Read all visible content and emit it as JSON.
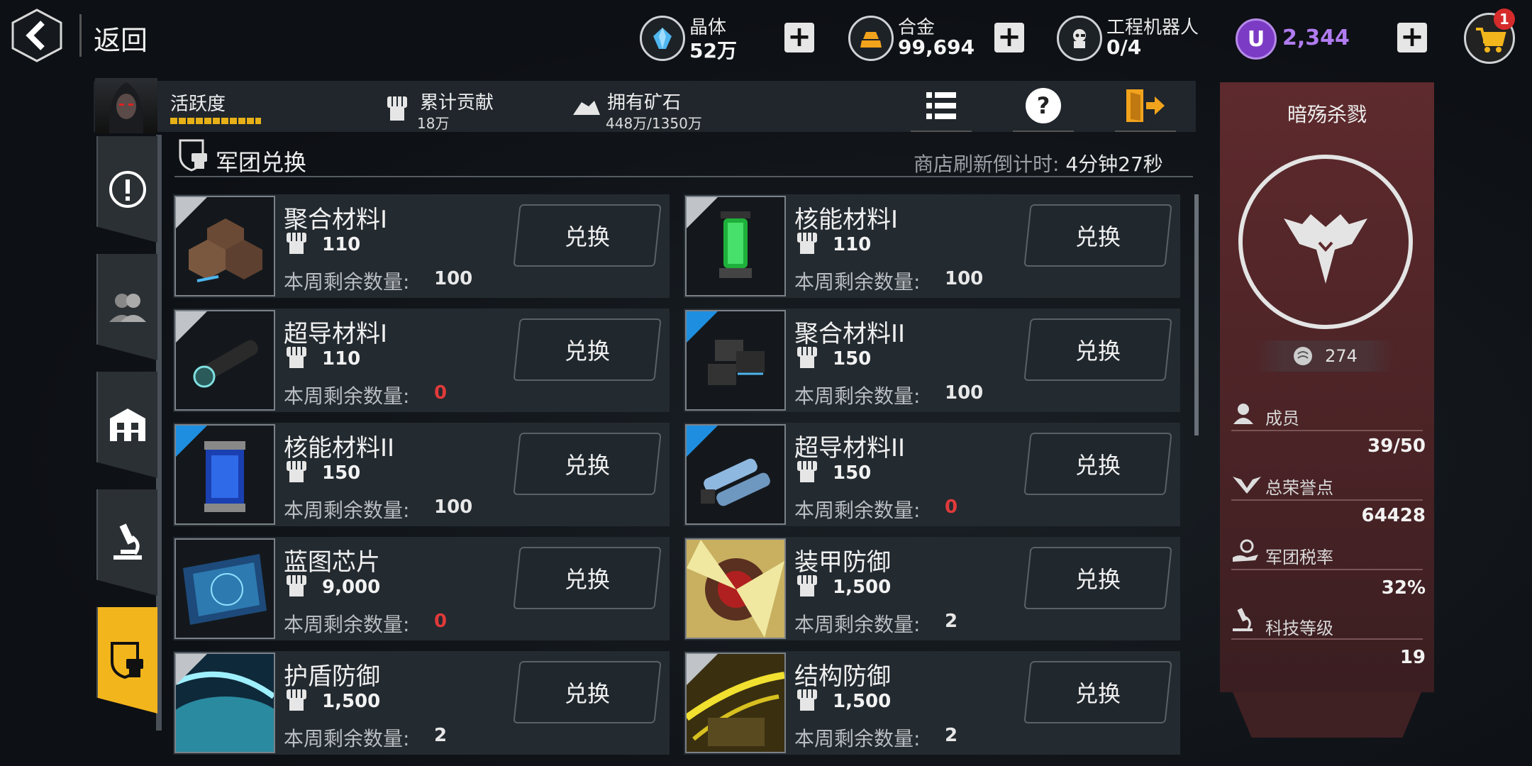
{
  "header": {
    "back_label": "返回",
    "resources": [
      {
        "name": "晶体",
        "value": "52万",
        "icon": "crystal-icon",
        "color": "#4fb6ef"
      },
      {
        "name": "合金",
        "value": "99,694",
        "icon": "alloy-icon",
        "color": "#f2a31c"
      },
      {
        "name": "工程机器人",
        "value": "0/4",
        "icon": "robot-icon"
      }
    ],
    "premium": {
      "symbol": "U",
      "value": "2,344",
      "color": "#b07cf0"
    },
    "cart_badge": "1"
  },
  "info_bar": {
    "activity_label": "活跃度",
    "contribution_label": "累计贡献",
    "contribution_value": "18万",
    "ore_label": "拥有矿石",
    "ore_value": "448万/1350万"
  },
  "section": {
    "title": "军团兑换",
    "refresh_label": "商店刷新倒计时:",
    "refresh_value": "4分钟27秒"
  },
  "items": [
    {
      "name": "聚合材料I",
      "cost": "110",
      "remain_label": "本周剩余数量:",
      "remain": "100",
      "button": "兑换",
      "tier": "grey"
    },
    {
      "name": "核能材料I",
      "cost": "110",
      "remain_label": "本周剩余数量:",
      "remain": "100",
      "button": "兑换",
      "tier": "grey"
    },
    {
      "name": "超导材料I",
      "cost": "110",
      "remain_label": "本周剩余数量:",
      "remain": "0",
      "button": "兑换",
      "tier": "grey"
    },
    {
      "name": "聚合材料II",
      "cost": "150",
      "remain_label": "本周剩余数量:",
      "remain": "100",
      "button": "兑换",
      "tier": "blue"
    },
    {
      "name": "核能材料II",
      "cost": "150",
      "remain_label": "本周剩余数量:",
      "remain": "100",
      "button": "兑换",
      "tier": "blue"
    },
    {
      "name": "超导材料II",
      "cost": "150",
      "remain_label": "本周剩余数量:",
      "remain": "0",
      "button": "兑换",
      "tier": "blue"
    },
    {
      "name": "蓝图芯片",
      "cost": "9,000",
      "remain_label": "本周剩余数量:",
      "remain": "0",
      "button": "兑换",
      "tier": "none"
    },
    {
      "name": "装甲防御",
      "cost": "1,500",
      "remain_label": "本周剩余数量:",
      "remain": "2",
      "button": "兑换",
      "tier": "none"
    },
    {
      "name": "护盾防御",
      "cost": "1,500",
      "remain_label": "本周剩余数量:",
      "remain": "2",
      "button": "兑换",
      "tier": "grey"
    },
    {
      "name": "结构防御",
      "cost": "1,500",
      "remain_label": "本周剩余数量:",
      "remain": "2",
      "button": "兑换",
      "tier": "grey"
    }
  ],
  "guild": {
    "name": "暗殇杀戮",
    "level": "274",
    "stats": [
      {
        "label": "成员",
        "value": "39/50",
        "icon": "member-icon"
      },
      {
        "label": "总荣誉点",
        "value": "64428",
        "icon": "wings-icon"
      },
      {
        "label": "军团税率",
        "value": "32%",
        "icon": "tax-icon"
      },
      {
        "label": "科技等级",
        "value": "19",
        "icon": "microscope-icon"
      }
    ]
  },
  "colors": {
    "accent": "#f2b51c",
    "zero": "#e03a3a",
    "panel": "#5e2a2d"
  }
}
